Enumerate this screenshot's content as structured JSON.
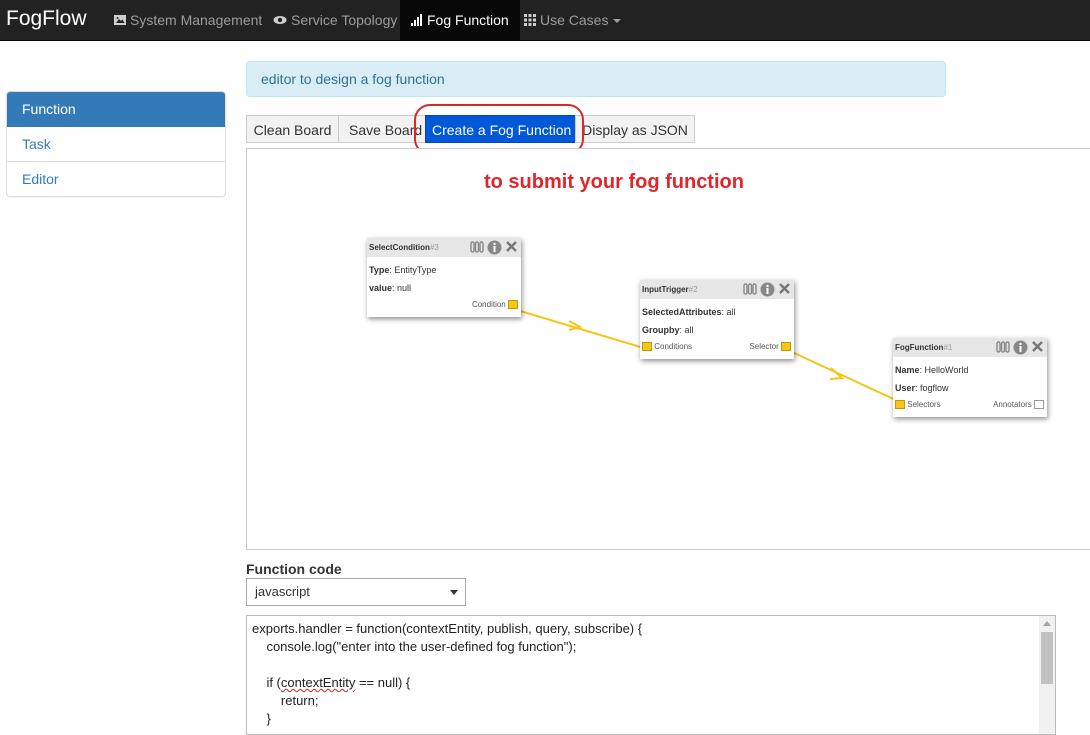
{
  "nav": {
    "brand": "FogFlow",
    "items": [
      {
        "label": "System Management",
        "icon": "picture-icon"
      },
      {
        "label": "Service Topology",
        "icon": "eye-icon"
      },
      {
        "label": "Fog Function",
        "icon": "bar-chart-icon",
        "active": true
      },
      {
        "label": "Use Cases",
        "icon": "grid-icon",
        "dropdown": true
      }
    ]
  },
  "sidebar": {
    "items": [
      {
        "label": "Function",
        "active": true
      },
      {
        "label": "Task"
      },
      {
        "label": "Editor"
      }
    ]
  },
  "info_banner": "editor to design a fog function",
  "toolbar": {
    "clean_board": "Clean Board",
    "save_board": "Save Board",
    "create_fog_function": "Create a Fog Function",
    "display_json": "Display as JSON"
  },
  "annotation": "to submit your fog function",
  "nodes": [
    {
      "title": "SelectCondition",
      "id": "#3",
      "props": [
        {
          "key": "Type",
          "value": "EntityType"
        },
        {
          "key": "value",
          "value": "null"
        }
      ],
      "port_left": "",
      "port_right": "Condition"
    },
    {
      "title": "InputTrigger",
      "id": "#2",
      "props": [
        {
          "key": "SelectedAttributes",
          "value": "all"
        },
        {
          "key": "Groupby",
          "value": "all"
        }
      ],
      "port_left": "Conditions",
      "port_right": "Selector"
    },
    {
      "title": "FogFunction",
      "id": "#1",
      "props": [
        {
          "key": "Name",
          "value": "HelloWorld"
        },
        {
          "key": "User",
          "value": "fogflow"
        }
      ],
      "port_left": "Selectors",
      "port_right": "Annotators"
    }
  ],
  "function_code": {
    "label": "Function code",
    "language": "javascript",
    "lines": [
      "exports.handler = function(contextEntity, publish, query, subscribe) {",
      "    console.log(\"enter into the user-defined fog function\");",
      "",
      "    if (",
      "        return;",
      "    }"
    ],
    "line4_squiggle": "contextEntity",
    "line4_rest": " == null) {"
  },
  "colors": {
    "navbar": "#222222",
    "primary_button": "#0057d8",
    "link": "#337ab7",
    "annotation": "#e0262a",
    "wire": "#f5c518"
  }
}
